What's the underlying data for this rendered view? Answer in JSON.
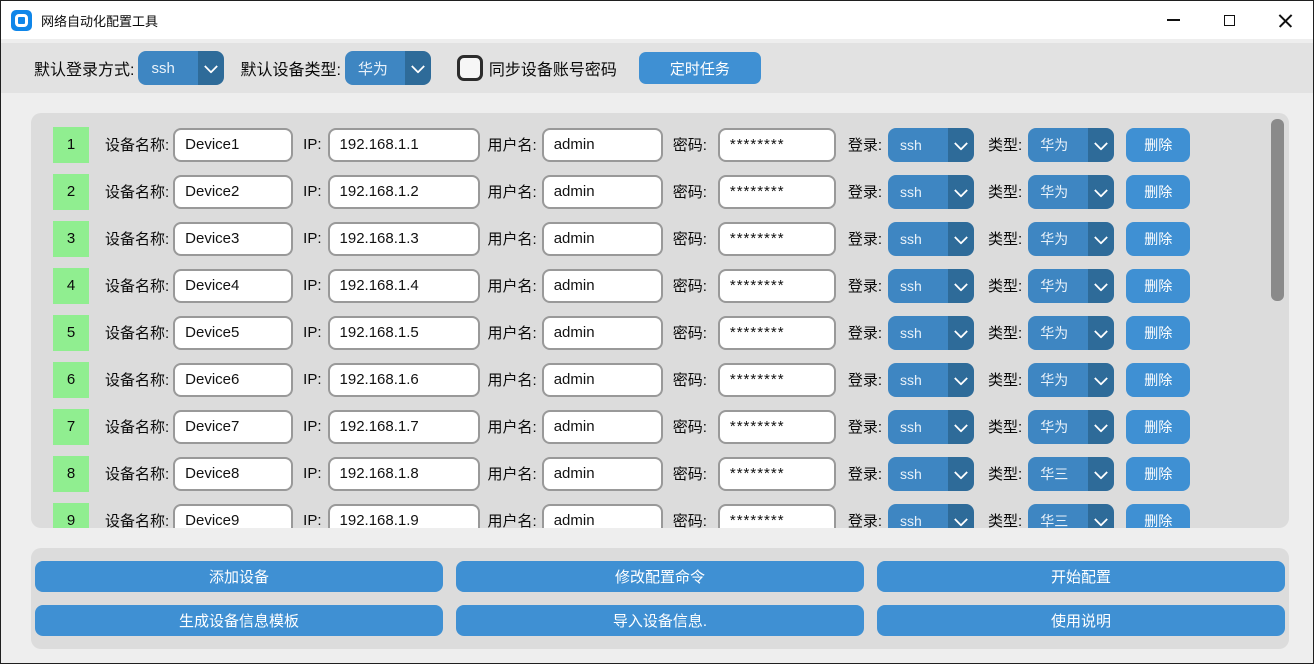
{
  "window": {
    "title": "网络自动化配置工具"
  },
  "toolbar": {
    "default_login_label": "默认登录方式:",
    "default_login_value": "ssh",
    "default_type_label": "默认设备类型:",
    "default_type_value": "华为",
    "sync_checkbox_label": "同步设备账号密码",
    "sync_checked": false,
    "scheduled_task_button": "定时任务"
  },
  "device_list": {
    "labels": {
      "name": "设备名称:",
      "ip": "IP:",
      "username": "用户名:",
      "password": "密码:",
      "login": "登录:",
      "type": "类型:",
      "delete": "删除"
    },
    "rows": [
      {
        "index": "1",
        "name": "Device1",
        "ip": "192.168.1.1",
        "username": "admin",
        "password": "********",
        "login": "ssh",
        "type": "华为"
      },
      {
        "index": "2",
        "name": "Device2",
        "ip": "192.168.1.2",
        "username": "admin",
        "password": "********",
        "login": "ssh",
        "type": "华为"
      },
      {
        "index": "3",
        "name": "Device3",
        "ip": "192.168.1.3",
        "username": "admin",
        "password": "********",
        "login": "ssh",
        "type": "华为"
      },
      {
        "index": "4",
        "name": "Device4",
        "ip": "192.168.1.4",
        "username": "admin",
        "password": "********",
        "login": "ssh",
        "type": "华为"
      },
      {
        "index": "5",
        "name": "Device5",
        "ip": "192.168.1.5",
        "username": "admin",
        "password": "********",
        "login": "ssh",
        "type": "华为"
      },
      {
        "index": "6",
        "name": "Device6",
        "ip": "192.168.1.6",
        "username": "admin",
        "password": "********",
        "login": "ssh",
        "type": "华为"
      },
      {
        "index": "7",
        "name": "Device7",
        "ip": "192.168.1.7",
        "username": "admin",
        "password": "********",
        "login": "ssh",
        "type": "华为"
      },
      {
        "index": "8",
        "name": "Device8",
        "ip": "192.168.1.8",
        "username": "admin",
        "password": "********",
        "login": "ssh",
        "type": "华三"
      },
      {
        "index": "9",
        "name": "Device9",
        "ip": "192.168.1.9",
        "username": "admin",
        "password": "********",
        "login": "ssh",
        "type": "华三"
      }
    ]
  },
  "actions": {
    "buttons": [
      [
        "添加设备",
        "修改配置命令",
        "开始配置"
      ],
      [
        "生成设备信息模板",
        "导入设备信息.",
        "使用说明"
      ]
    ]
  },
  "colors": {
    "accent_blue": "#3f90d3",
    "dropdown_blue": "#3e86c2",
    "dropdown_arrow_blue": "#2e6b99",
    "badge_green": "#90ee90",
    "panel_gray": "#dcdcdc",
    "titlebar_white": "#ffffff"
  }
}
